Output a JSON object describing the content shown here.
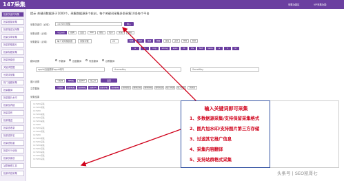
{
  "app": {
    "title": "147采集",
    "version": "v1.0.1"
  },
  "top_links": [
    "采集功能区",
    "VIP采集功能"
  ],
  "sidebar": {
    "items": [
      {
        "label": "批量关键词采集"
      },
      {
        "label": "批量链接采集"
      },
      {
        "label": "批量指定站采集"
      },
      {
        "label": "批量文章采集"
      },
      {
        "label": "批量抓取图片"
      },
      {
        "label": "批量标题采集"
      },
      {
        "label": "批量伪原创"
      },
      {
        "label": "关键词挖掘"
      },
      {
        "label": "长尾词采集"
      },
      {
        "label": "热门话题采集"
      },
      {
        "label": "批量翻译"
      },
      {
        "label": "批量图片水印"
      },
      {
        "label": "批量加内链"
      },
      {
        "label": "批量发布"
      },
      {
        "label": "批量推送"
      },
      {
        "label": "批量查收录"
      },
      {
        "label": "批量查排名"
      },
      {
        "label": "批量查权重"
      },
      {
        "label": "批量SEO优化"
      },
      {
        "label": "批量伪原创"
      },
      {
        "label": "站群管理工具"
      },
      {
        "label": "批量内容采集"
      }
    ],
    "active_index": 0
  },
  "notice": {
    "label": "提示",
    "text": "关键词数据多于1000个，采集数据源多个轮训，每个关键词采集多条采集10条每个平台"
  },
  "keyword_row": {
    "label": "采集关键词（必填）",
    "value": "147SEO采集",
    "button": "导入"
  },
  "source_row": {
    "label": "采集设置（必填）",
    "chips": [
      "今日头条",
      "搜狗",
      "百度",
      "360",
      "微信",
      "知乎",
      "新浪",
      "网易"
    ],
    "chips_on": [
      0
    ]
  },
  "count_row": {
    "label": "采集数量（必填）",
    "fields": [
      "每个词采集篇数",
      "采集字数",
      "20"
    ],
    "chips": [
      "标题",
      "图片",
      "段落",
      "视频",
      "链接",
      "正文",
      "作者",
      "原文"
    ],
    "chips_on": [
      0,
      1,
      2,
      3
    ]
  },
  "tags_row": {
    "chips": [
      "a",
      "p",
      "img",
      "strong",
      "span",
      "h1",
      "div",
      "font",
      "table",
      "ul",
      "li",
      "br"
    ],
    "chips_on": [
      0,
      1,
      2,
      3,
      4,
      5,
      6,
      7,
      8,
      9,
      10,
      11
    ]
  },
  "translate_row": {
    "label": "翻译设置",
    "options": [
      "不翻译",
      "百度翻译",
      "有道翻译",
      "谷歌翻译"
    ]
  },
  "api_row": {
    "fields": [
      "appid/百度翻译appid填写",
      "AccessKey",
      "SecretKey"
    ]
  },
  "image_row": {
    "label": "图片设置",
    "chips": [
      "不处理",
      "本地化",
      "加水印",
      "第三方"
    ],
    "chips_on": [
      1
    ],
    "button": "设置"
  },
  "replace_row": {
    "label": "文章替换",
    "chips": [
      "不替换",
      "替换联系方式",
      "替换网址",
      "替换QQ",
      "替换手机号",
      "替换邮箱",
      "替换微信",
      "删除首段",
      "删除尾段",
      "随机段落",
      "插入关键词",
      "插入图片",
      "伪原创"
    ],
    "chips_on": [
      0,
      1,
      2,
      3,
      4,
      5
    ]
  },
  "content_area": {
    "label": "采集结果",
    "lines": [
      "147SEO采集",
      "147SEO采集",
      "147SEO",
      "147SEO采集",
      "147SEO采集",
      "147SEO采集",
      "147SEO",
      "147SEO采集",
      "147SEO采集",
      "147SEO",
      "147SEO采集",
      "147SEO采集",
      "147SEO采集",
      "147SEO采集",
      "147SEO采集",
      "147SEO采集",
      "147SEO采集"
    ]
  },
  "annotation": {
    "heading": "输入关键词即可采集",
    "items": [
      "1、多数据源采集/支持保留采集格式",
      "2、图片加水印/支持图片第三方存储",
      "3、过滤其它推广信息",
      "4、采集内容翻译",
      "5、支持站群格式采集"
    ],
    "color": "#d0021b"
  },
  "watermark": "头条号 | SEO凯哥七",
  "colors": {
    "brand": "#6b3fa0",
    "annotation": "#d0021b",
    "box_border": "#2f4fa0"
  }
}
